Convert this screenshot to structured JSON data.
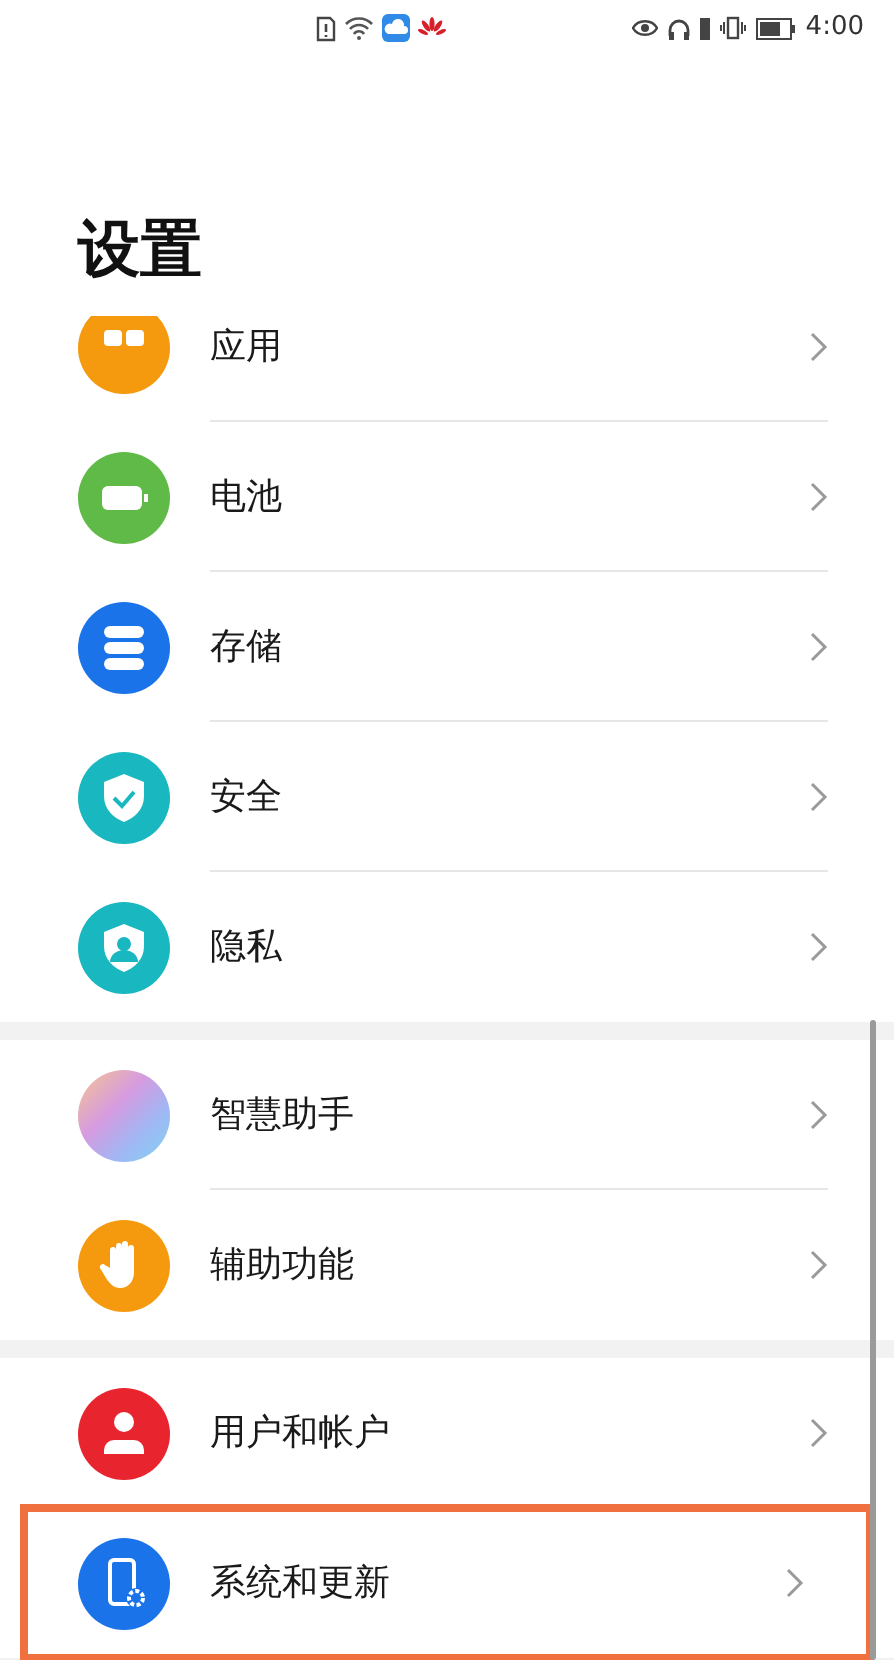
{
  "status_bar": {
    "time": "4:00"
  },
  "title": "设置",
  "groups": [
    {
      "items": [
        {
          "label": "应用",
          "highlighted": false
        },
        {
          "label": "电池",
          "highlighted": false
        },
        {
          "label": "存储",
          "highlighted": false
        },
        {
          "label": "安全",
          "highlighted": false
        },
        {
          "label": "隐私",
          "highlighted": false
        }
      ]
    },
    {
      "items": [
        {
          "label": "智慧助手",
          "highlighted": false
        },
        {
          "label": "辅助功能",
          "highlighted": false
        }
      ]
    },
    {
      "items": [
        {
          "label": "用户和帐户",
          "highlighted": false
        },
        {
          "label": "系统和更新",
          "highlighted": true
        }
      ]
    }
  ]
}
